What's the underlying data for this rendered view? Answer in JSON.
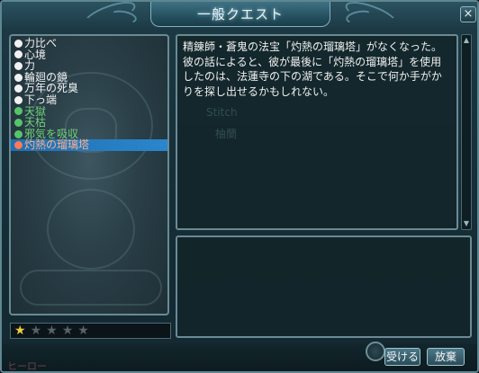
{
  "window": {
    "title": "一般クエスト",
    "close_label": "×"
  },
  "quest_list": [
    {
      "label": "力比べ",
      "state": "white"
    },
    {
      "label": "心境",
      "state": "white"
    },
    {
      "label": "力",
      "state": "white"
    },
    {
      "label": "輪廻の鏡",
      "state": "white"
    },
    {
      "label": "万年の死臭",
      "state": "white"
    },
    {
      "label": "下っ端",
      "state": "white"
    },
    {
      "label": "天獄",
      "state": "green"
    },
    {
      "label": "天枯",
      "state": "green"
    },
    {
      "label": "邪気を吸収",
      "state": "green"
    },
    {
      "label": "灼熱の瑠璃塔",
      "state": "selected"
    }
  ],
  "difficulty": {
    "stars_filled": 1,
    "stars_total": 5,
    "star_glyph": "★"
  },
  "description": {
    "text": "精錬師・蒼鬼の法宝「灼熱の瑠璃塔」がなくなった。彼の話によると、彼が最後に「灼熱の瑠璃塔」を使用したのは、法蓮寺の下の湖である。そこで何か手がかりを探し出せるかもしれない。",
    "ghost_name": "Stitch",
    "ghost_text": "柚蘭"
  },
  "scrollbar": {
    "up_glyph": "▲",
    "down_glyph": "▼"
  },
  "buttons": {
    "accept_label": "受ける",
    "abandon_label": "放棄"
  },
  "bottom": {
    "label": "ヒーロー"
  },
  "colors": {
    "frame": "#5e8792",
    "selected_bg": "#2b86cc",
    "selected_text": "#ffb08a",
    "completed_text": "#6fd27a",
    "star_on": "#f2cf3a"
  }
}
